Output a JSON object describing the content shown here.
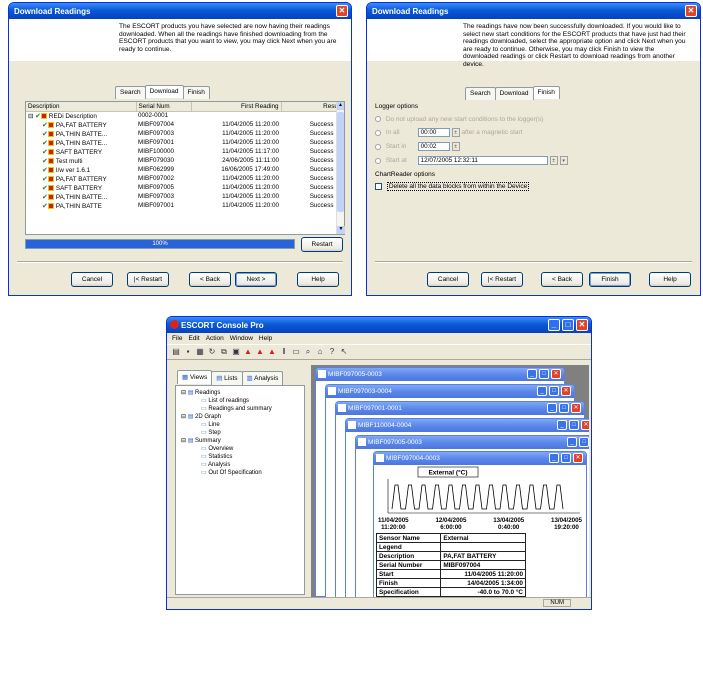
{
  "dialog_download": {
    "title": "Download Readings",
    "intro": "The ESCORT products you have selected are now having their readings downloaded. When all the readings have finished downloading from the ESCORT products that you want to view, you may click Next when you are ready to continue.",
    "tabs": [
      "Search",
      "Download",
      "Finish"
    ],
    "columns": [
      "Description",
      "Serial Num",
      "First Reading",
      "Result"
    ],
    "group": {
      "description": "REDi Description",
      "serial": "0002-0001"
    },
    "rows": [
      {
        "description": "PA,FAT BATTERY",
        "serial": "MIBF097004",
        "first": "11/04/2005 11:20:00",
        "result": "Success"
      },
      {
        "description": "PA,THIN BATTE...",
        "serial": "MIBF097003",
        "first": "11/04/2005 11:20:00",
        "result": "Success"
      },
      {
        "description": "PA,THIN BATTE...",
        "serial": "MIBF097001",
        "first": "11/04/2005 11:20:00",
        "result": "Success"
      },
      {
        "description": "SAFT BATTERY",
        "serial": "MIBF100000",
        "first": "11/04/2005 11:17:00",
        "result": "Success"
      },
      {
        "description": "Test multi",
        "serial": "MIBF079030",
        "first": "24/06/2005 11:11:00",
        "result": "Success"
      },
      {
        "description": "I/w ver 1.6.1",
        "serial": "MIBF062999",
        "first": "16/06/2005 17:49:00",
        "result": "Success"
      },
      {
        "description": "PA,FAT BATTERY",
        "serial": "MIBF097002",
        "first": "11/04/2005 11:20:00",
        "result": "Success"
      },
      {
        "description": "SAFT BATTERY",
        "serial": "MIBF097005",
        "first": "11/04/2005 11:20:00",
        "result": "Success"
      },
      {
        "description": "PA,THIN BATTE...",
        "serial": "MIBF097003",
        "first": "11/04/2005 11:20:00",
        "result": "Success"
      },
      {
        "description": "PA,THIN BATTE",
        "serial": "MIBF097001",
        "first": "11/04/2005 11:20:00",
        "result": "Success"
      }
    ],
    "progress_label": "100%",
    "progress": 1.0,
    "restart_label": "Restart",
    "buttons": {
      "cancel": "Cancel",
      "restart": "|< Restart",
      "back": "< Back",
      "next": "Next >",
      "help": "Help"
    }
  },
  "dialog_finish": {
    "title": "Download Readings",
    "intro": "The readings have now been successfully downloaded. If you would like to select new start conditions for the ESCORT products that have just had their readings downloaded, select the appropriate option and click Next when you are ready to continue. Otherwise, you may click Finish to view the downloaded readings or click Restart to download readings from another device.",
    "tabs": [
      "Search",
      "Download",
      "Finish"
    ],
    "logger_options": "Logger options",
    "opt1": "Do not upload any new start conditions to the logger(s)",
    "opt2_label": "In all",
    "opt2_value": "00:00",
    "opt2_suffix": "after a magnetic start",
    "opt3_label": "Start in",
    "opt3_value": "00:02",
    "opt4_label": "Start at",
    "opt4_value": "12/07/2005 12:32:11",
    "chartreader_options": "ChartReader options",
    "delete_label": "Delete all the data blocks from within the Device",
    "buttons": {
      "cancel": "Cancel",
      "restart": "|< Restart",
      "back": "< Back",
      "finish": "Finish",
      "help": "Help"
    }
  },
  "console": {
    "title": "ESCORT Console Pro",
    "menus": [
      "File",
      "Edit",
      "Action",
      "Window",
      "Help"
    ],
    "side_tabs": [
      "Views",
      "Lists",
      "Analysis"
    ],
    "tree": [
      {
        "label": "Readings",
        "level": 0
      },
      {
        "label": "List of readings",
        "level": 1
      },
      {
        "label": "Readings and summary",
        "level": 1
      },
      {
        "label": "2D Graph",
        "level": 0
      },
      {
        "label": "Line",
        "level": 1
      },
      {
        "label": "Step",
        "level": 1
      },
      {
        "label": "Summary",
        "level": 0
      },
      {
        "label": "Overview",
        "level": 1
      },
      {
        "label": "Statistics",
        "level": 1
      },
      {
        "label": "Analysis",
        "level": 1
      },
      {
        "label": "Out Of Specification",
        "level": 1
      }
    ],
    "child_windows": [
      "MIBF097005-0003",
      "MIBF097003-0004",
      "MIBF097001-0001",
      "MIBF110004-0004",
      "MIBF097005-0003"
    ],
    "front_window": {
      "title": "MIBF097004-0003",
      "chart_legend": "External (°C)",
      "x_ticks": [
        {
          "date": "11/04/2005",
          "time": "11:20:00"
        },
        {
          "date": "12/04/2005",
          "time": "6:00:00"
        },
        {
          "date": "13/04/2005",
          "time": "0:40:00"
        },
        {
          "date": "13/04/2005",
          "time": "19:20:00"
        }
      ],
      "summary": [
        {
          "label": "Sensor Name",
          "value": "External"
        },
        {
          "label": "Legend",
          "value": ""
        },
        {
          "label": "Description",
          "value": "PA,FAT BATTERY"
        },
        {
          "label": "Serial Number",
          "value": "MIBF097004"
        },
        {
          "label": "Start",
          "value": "11/04/2005 11:20:00"
        },
        {
          "label": "Finish",
          "value": "14/04/2005 1:34:00"
        },
        {
          "label": "Specification",
          "value": "-40.0 to 70.0 °C"
        }
      ]
    },
    "status_num": "NUM"
  }
}
